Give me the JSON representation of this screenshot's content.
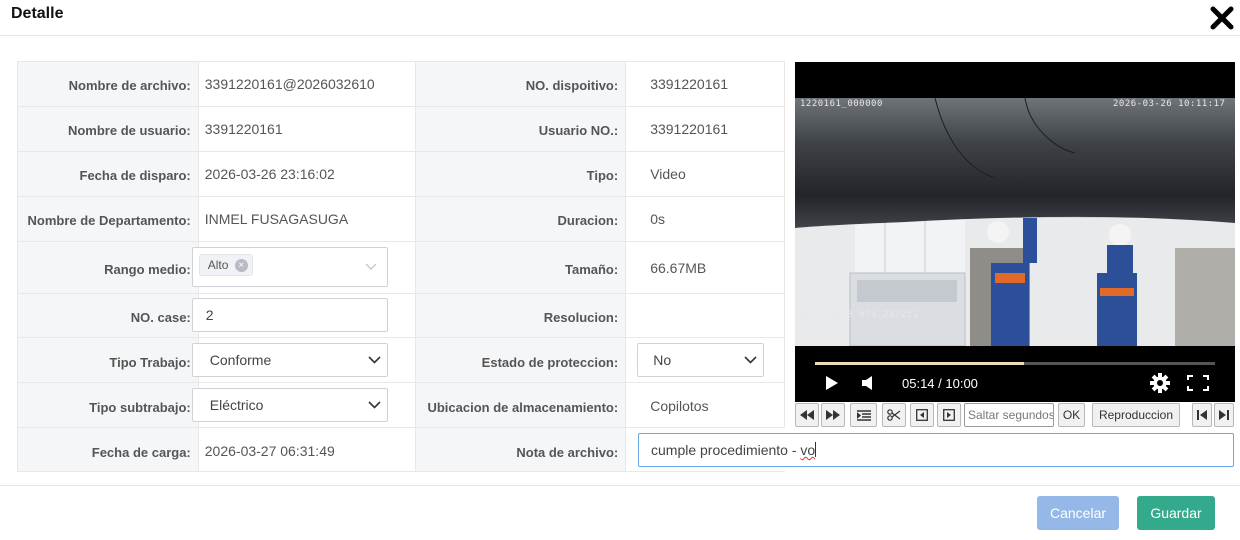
{
  "dialog": {
    "title": "Detalle"
  },
  "fields": {
    "nombre_archivo": {
      "label": "Nombre de archivo:",
      "value": "3391220161@2026032610"
    },
    "no_dispositivo": {
      "label": "NO. dispoitivo:",
      "value": "3391220161"
    },
    "nombre_usuario": {
      "label": "Nombre de usuario:",
      "value": "3391220161"
    },
    "usuario_no": {
      "label": "Usuario NO.:",
      "value": "3391220161"
    },
    "fecha_disparo": {
      "label": "Fecha de disparo:",
      "value": "2026-03-26 23:16:02"
    },
    "tipo": {
      "label": "Tipo:",
      "value": "Video"
    },
    "departamento": {
      "label": "Nombre de Departamento:",
      "value": "INMEL FUSAGASUGA"
    },
    "duracion": {
      "label": "Duracion:",
      "value": "0s"
    },
    "rango_medio": {
      "label": "Rango medio:",
      "tag": "Alto",
      "tag_remove": "×"
    },
    "tamano": {
      "label": "Tamaño:",
      "value": "66.67MB"
    },
    "no_case": {
      "label": "NO. case:",
      "value": "2"
    },
    "resolucion": {
      "label": "Resolucion:",
      "value": ""
    },
    "tipo_trabajo": {
      "label": "Tipo Trabajo:",
      "value": "Conforme"
    },
    "estado_proteccion": {
      "label": "Estado de proteccion:",
      "value": "No"
    },
    "tipo_subtrabajo": {
      "label": "Tipo subtrabajo:",
      "value": "Eléctrico"
    },
    "ubicacion": {
      "label": "Ubicacion de almacenamiento:",
      "value": "Copilotos"
    },
    "fecha_carga": {
      "label": "Fecha de carga:",
      "value": "2026-03-27 06:31:49"
    },
    "nota_archivo": {
      "label": "Nota de archivo:",
      "value_main": "cumple procedimiento - ",
      "value_typo": "vo"
    }
  },
  "video": {
    "osd_top_left": "1220161_000000",
    "osd_top_right": "2026-03-26 10:11:17",
    "osd_coords": "N4.529070  W74.237251",
    "current_time": "05:14",
    "duration": "10:00",
    "time_display": "05:14 / 10:00",
    "progress": 0.523
  },
  "toolbar": {
    "seek_placeholder": "Saltar segundos",
    "ok_label": "OK",
    "playback_label": "Reproduccion"
  },
  "footer": {
    "cancel_label": "Cancelar",
    "save_label": "Guardar"
  },
  "colors": {
    "save": "#34aa8d",
    "cancel": "#95b8e8",
    "focus_border": "#6aa7e6"
  }
}
